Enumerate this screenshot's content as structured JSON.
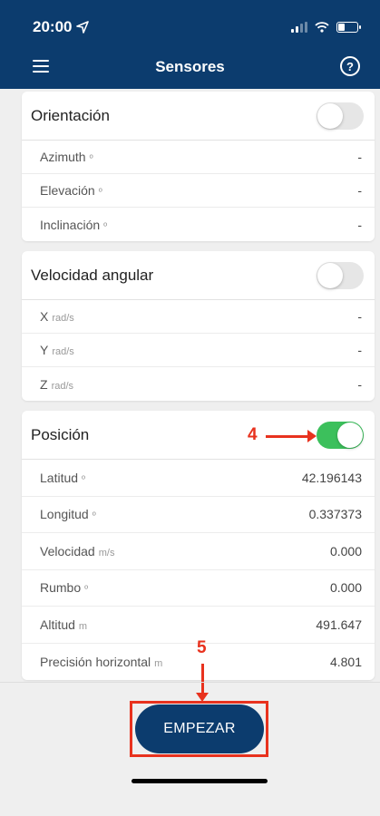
{
  "status_bar": {
    "time": "20:00"
  },
  "header": {
    "title": "Sensores",
    "menu_icon": "hamburger-icon",
    "help_icon": "question-circle-icon",
    "help_glyph": "?"
  },
  "colors": {
    "primary": "#0c3c6e",
    "toggle_on": "#3cc05c",
    "annotation": "#e8321e"
  },
  "sections": [
    {
      "title": "Orientación",
      "toggle_on": false,
      "rows": [
        {
          "label": "Azimuth",
          "unit": "º",
          "value": "-"
        },
        {
          "label": "Elevación",
          "unit": "º",
          "value": "-"
        },
        {
          "label": "Inclinación",
          "unit": "º",
          "value": "-"
        }
      ]
    },
    {
      "title": "Velocidad angular",
      "toggle_on": false,
      "rows": [
        {
          "label": "X",
          "unit": "rad/s",
          "value": "-"
        },
        {
          "label": "Y",
          "unit": "rad/s",
          "value": "-"
        },
        {
          "label": "Z",
          "unit": "rad/s",
          "value": "-"
        }
      ]
    },
    {
      "title": "Posición",
      "toggle_on": true,
      "rows": [
        {
          "label": "Latitud",
          "unit": "º",
          "value": "42.196143"
        },
        {
          "label": "Longitud",
          "unit": "º",
          "value": "0.337373"
        },
        {
          "label": "Velocidad",
          "unit": "m/s",
          "value": "0.000"
        },
        {
          "label": "Rumbo",
          "unit": "º",
          "value": "0.000"
        },
        {
          "label": "Altitud",
          "unit": "m",
          "value": "491.647"
        },
        {
          "label": "Precisión horizontal",
          "unit": "m",
          "value": "4.801"
        }
      ]
    }
  ],
  "annotations": {
    "step4": "4",
    "step5": "5"
  },
  "start_button": {
    "label": "EMPEZAR"
  }
}
